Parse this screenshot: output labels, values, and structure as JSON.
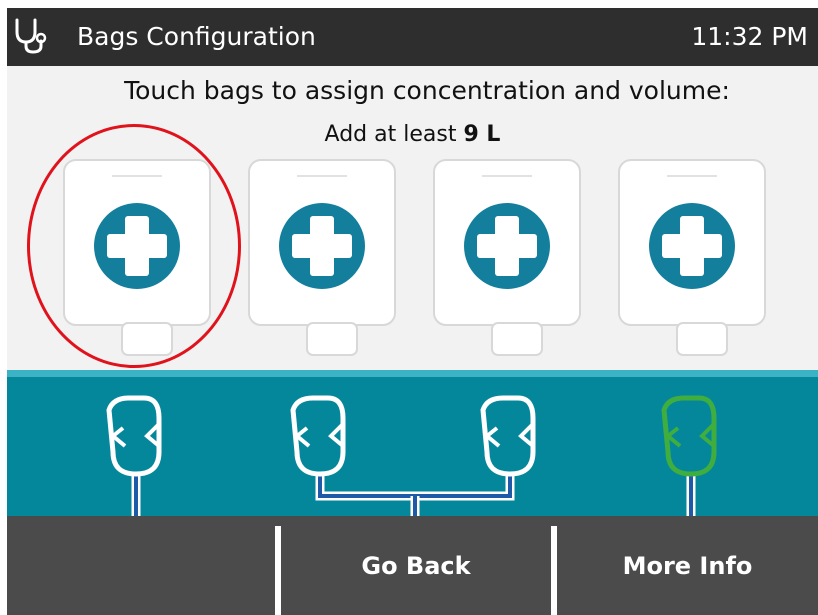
{
  "header": {
    "title": "Bags Configuration",
    "time": "11:32 PM",
    "icon": "stethoscope-icon"
  },
  "instructions": {
    "line1": "Touch bags to assign concentration and volume:",
    "prefix": "Add at least",
    "amount": "9 L"
  },
  "bags": [
    {
      "icon": "add-plus-icon",
      "highlighted": true
    },
    {
      "icon": "add-plus-icon",
      "highlighted": false
    },
    {
      "icon": "add-plus-icon",
      "highlighted": false
    },
    {
      "icon": "add-plus-icon",
      "highlighted": false
    }
  ],
  "connectors": [
    {
      "status": "unassigned"
    },
    {
      "status": "unassigned"
    },
    {
      "status": "unassigned"
    },
    {
      "status": "connected"
    }
  ],
  "footer": {
    "left_label": "",
    "back_label": "Go Back",
    "info_label": "More Info"
  },
  "colors": {
    "teal": "#05879b",
    "plus_blue": "#137f9d",
    "connected_green": "#3fae3f",
    "highlight_red": "#e0131c",
    "footer_gray": "#4b4b4b"
  }
}
